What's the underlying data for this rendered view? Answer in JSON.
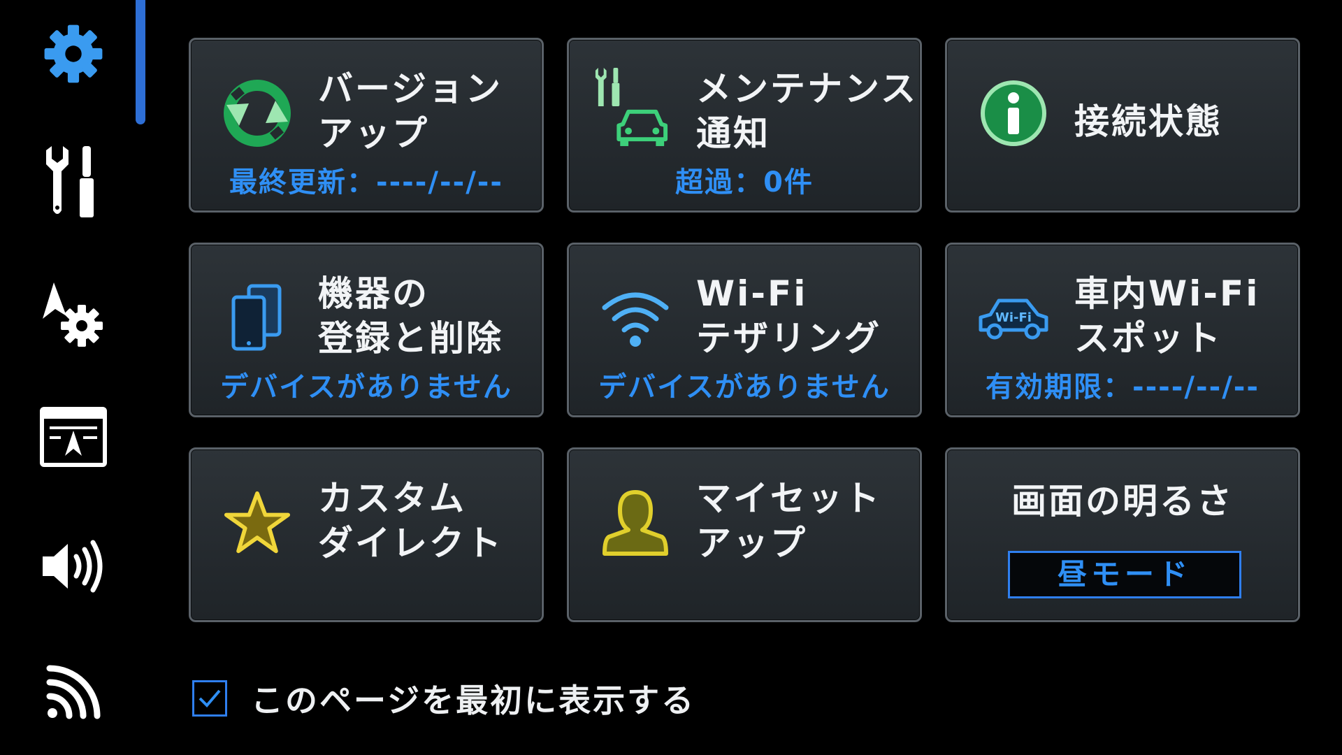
{
  "colors": {
    "accent": "#2f8ff5",
    "icon_blue": "#3a9bf0",
    "icon_green": "#1fa855",
    "icon_yellow": "#d8c21f",
    "tile_border": "#5a6168"
  },
  "sidebar": {
    "items": [
      {
        "icon": "gear-icon",
        "active": true
      },
      {
        "icon": "wrench-screwdriver-icon",
        "active": false
      },
      {
        "icon": "navigation-settings-icon",
        "active": false
      },
      {
        "icon": "display-screen-icon",
        "active": false
      },
      {
        "icon": "speaker-volume-icon",
        "active": false
      },
      {
        "icon": "wireless-signal-icon",
        "active": false
      }
    ]
  },
  "tiles": [
    {
      "title": "バージョン\nアップ",
      "sub": "最終更新：----/--/--",
      "icon": "refresh-icon"
    },
    {
      "title": "メンテナンス\n通知",
      "sub": "超過：0件",
      "icon": "maintenance-car-icon"
    },
    {
      "title": "接続状態",
      "sub": "",
      "icon": "info-icon"
    },
    {
      "title": "機器の\n登録と削除",
      "sub": "デバイスがありません",
      "icon": "phone-devices-icon"
    },
    {
      "title": "Wi-Fi\nテザリング",
      "sub": "デバイスがありません",
      "icon": "wifi-icon"
    },
    {
      "title": "車内Wi-Fi\nスポット",
      "sub": "有効期限：----/--/--",
      "icon": "car-wifi-icon",
      "badge": "Wi-Fi"
    },
    {
      "title": "カスタム\nダイレクト",
      "sub": "",
      "icon": "star-icon"
    },
    {
      "title": "マイセット\nアップ",
      "sub": "",
      "icon": "person-icon"
    },
    {
      "title": "画面の明るさ",
      "sub": "",
      "icon": "",
      "mode_button": "昼モード"
    }
  ],
  "footer": {
    "checkbox_checked": true,
    "label": "このページを最初に表示する"
  }
}
